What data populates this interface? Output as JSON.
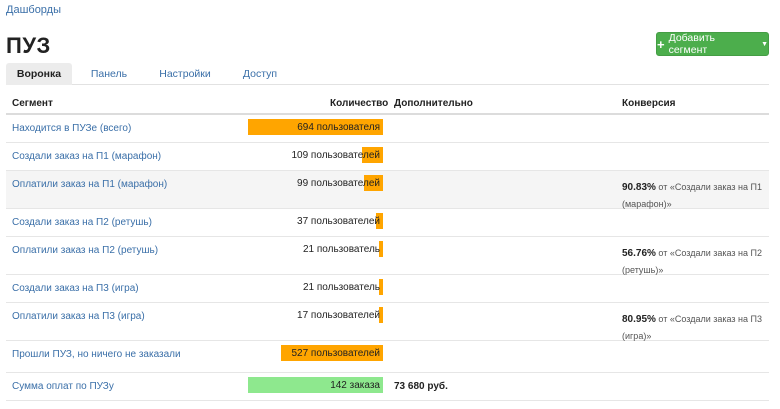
{
  "breadcrumb": "Дашборды",
  "title": "ПУЗ",
  "add_button": "Добавить сегмент",
  "tabs": [
    "Воронка",
    "Панель",
    "Настройки",
    "Доступ"
  ],
  "columns": {
    "segment": "Сегмент",
    "count": "Количество",
    "extra": "Дополнительно",
    "conversion": "Конверсия"
  },
  "rows": [
    {
      "segment": "Находится в ПУЗе (всего)",
      "count_label": "694 пользователя",
      "fill_fraction": 1.0,
      "bar_color": "#ffa500",
      "extra": "",
      "conv_pct": "",
      "conv_text": "",
      "shaded": false
    },
    {
      "segment": "Создали заказ на П1 (марафон)",
      "count_label": "109 пользователей",
      "fill_fraction": 0.157,
      "bar_color": "#ffa500",
      "extra": "",
      "conv_pct": "",
      "conv_text": "",
      "shaded": false
    },
    {
      "segment": "Оплатили заказ на П1 (марафон)",
      "count_label": "99 пользователей",
      "fill_fraction": 0.143,
      "bar_color": "#ffa500",
      "extra": "",
      "conv_pct": "90.83%",
      "conv_text": " от «Создали заказ на П1 (марафон)»",
      "shaded": true
    },
    {
      "segment": "Создали заказ на П2 (ретушь)",
      "count_label": "37 пользователей",
      "fill_fraction": 0.053,
      "bar_color": "#ffa500",
      "extra": "",
      "conv_pct": "",
      "conv_text": "",
      "shaded": false
    },
    {
      "segment": "Оплатили заказ на П2 (ретушь)",
      "count_label": "21 пользователь",
      "fill_fraction": 0.03,
      "bar_color": "#ffa500",
      "extra": "",
      "conv_pct": "56.76%",
      "conv_text": " от «Создали заказ на П2 (ретушь)»",
      "shaded": false
    },
    {
      "segment": "Создали заказ на П3 (игра)",
      "count_label": "21 пользователь",
      "fill_fraction": 0.03,
      "bar_color": "#ffa500",
      "extra": "",
      "conv_pct": "",
      "conv_text": "",
      "shaded": false
    },
    {
      "segment": "Оплатили заказ на П3 (игра)",
      "count_label": "17 пользователей",
      "fill_fraction": 0.024,
      "bar_color": "#ffa500",
      "extra": "",
      "conv_pct": "80.95%",
      "conv_text": " от «Создали заказ на П3 (игра)»",
      "shaded": false
    },
    {
      "segment": "Прошли ПУЗ, но ничего не заказали",
      "count_label": "527 пользователей",
      "fill_fraction": 0.759,
      "bar_color": "#ffa500",
      "extra": "",
      "conv_pct": "",
      "conv_text": "",
      "shaded": false
    },
    {
      "segment": "Сумма оплат по ПУЗу",
      "count_label": "142 заказа",
      "fill_fraction": 1.0,
      "bar_color": "#8ee88e",
      "extra": "73 680 руб.",
      "conv_pct": "",
      "conv_text": "",
      "shaded": false
    }
  ]
}
